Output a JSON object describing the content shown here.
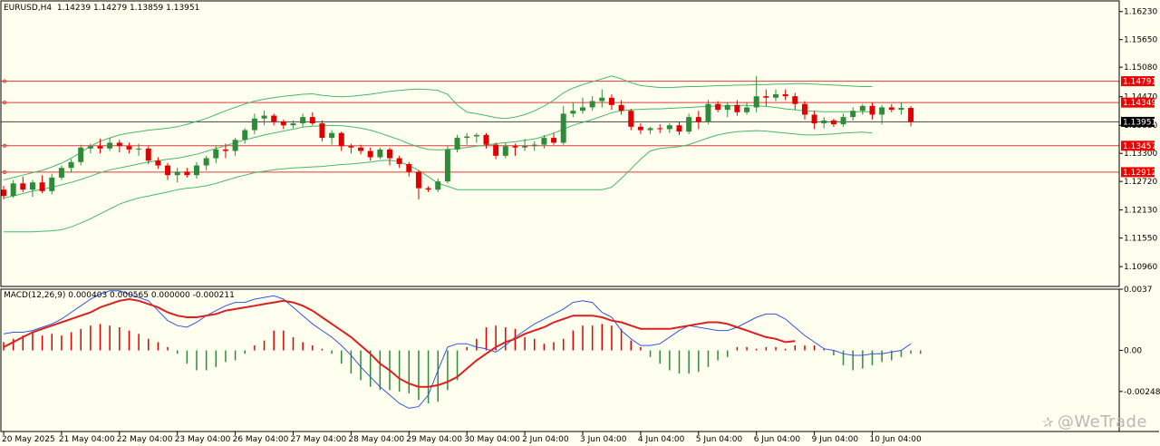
{
  "header": {
    "symbol": "EURUSD,H4",
    "open": "1.14239",
    "high": "1.14279",
    "low": "1.13859",
    "close": "1.13951"
  },
  "macd": {
    "label": "MACD(12,26,9)",
    "values": "0.000403 0.000565 0.000000 -0.000211"
  },
  "watermark": "@WeTrade",
  "colors": {
    "background": "#fffff0",
    "bull": "#2e8b3a",
    "bear": "#e00000",
    "bands": "#47b86a",
    "level_line": "#e53935",
    "level_box": "#f00000",
    "current_box": "#000000",
    "macd_line": "#3355dd",
    "signal_line": "#dd1f1f"
  },
  "price_axis": {
    "labels": [
      "1.16230",
      "1.15650",
      "1.15080",
      "1.14470",
      "1.13880",
      "1.13300",
      "1.12720",
      "1.12130",
      "1.11550",
      "1.10960"
    ],
    "range": [
      1.1055,
      1.1645
    ]
  },
  "levels": [
    {
      "label": "1.14791",
      "value": 1.14791
    },
    {
      "label": "1.14349",
      "value": 1.14349
    },
    {
      "label": "1.13457",
      "value": 1.13457
    },
    {
      "label": "1.12912",
      "value": 1.12912
    }
  ],
  "current": {
    "label": "1.13951",
    "value": 1.13951
  },
  "macd_axis": {
    "labels": [
      "0.0037",
      "0.00",
      "-0.002481"
    ],
    "range": [
      -0.0049,
      0.0037
    ]
  },
  "time_axis": {
    "labels": [
      "20 May 2025",
      "21 May 04:00",
      "22 May 04:00",
      "23 May 04:00",
      "26 May 04:00",
      "27 May 04:00",
      "28 May 04:00",
      "29 May 04:00",
      "30 May 04:00",
      "2 Jun 04:00",
      "3 Jun 04:00",
      "4 Jun 04:00",
      "5 Jun 04:00",
      "6 Jun 04:00",
      "9 Jun 04:00",
      "10 Jun 04:00"
    ],
    "label_candle_index": [
      0,
      6,
      12,
      18,
      24,
      30,
      36,
      42,
      48,
      54,
      60,
      66,
      72,
      78,
      84,
      90
    ]
  },
  "chart_data": {
    "type": "candlestick",
    "symbol": "EURUSD",
    "timeframe": "H4",
    "indicators": [
      "Bollinger Bands",
      "MACD(12,26,9)"
    ],
    "candles": [
      [
        1.1255,
        1.1263,
        1.1235,
        1.1242
      ],
      [
        1.1242,
        1.1275,
        1.1238,
        1.1268
      ],
      [
        1.1268,
        1.1282,
        1.125,
        1.1255
      ],
      [
        1.1255,
        1.1275,
        1.124,
        1.127
      ],
      [
        1.127,
        1.1285,
        1.1248,
        1.1252
      ],
      [
        1.1252,
        1.1288,
        1.1245,
        1.128
      ],
      [
        1.128,
        1.1305,
        1.1275,
        1.13
      ],
      [
        1.13,
        1.1318,
        1.129,
        1.1312
      ],
      [
        1.1312,
        1.1348,
        1.1305,
        1.1342
      ],
      [
        1.134,
        1.135,
        1.133,
        1.1345
      ],
      [
        1.1345,
        1.136,
        1.133,
        1.134
      ],
      [
        1.134,
        1.1362,
        1.1335,
        1.1352
      ],
      [
        1.1352,
        1.1358,
        1.1332,
        1.1345
      ],
      [
        1.1345,
        1.1352,
        1.133,
        1.1338
      ],
      [
        1.1338,
        1.135,
        1.1325,
        1.134
      ],
      [
        1.134,
        1.1345,
        1.1308,
        1.1315
      ],
      [
        1.1315,
        1.1322,
        1.1298,
        1.1305
      ],
      [
        1.1305,
        1.131,
        1.1275,
        1.1285
      ],
      [
        1.1285,
        1.13,
        1.127,
        1.1292
      ],
      [
        1.1292,
        1.13,
        1.128,
        1.1285
      ],
      [
        1.1285,
        1.1312,
        1.1278,
        1.1305
      ],
      [
        1.1305,
        1.1325,
        1.1295,
        1.132
      ],
      [
        1.132,
        1.1345,
        1.131,
        1.1338
      ],
      [
        1.1338,
        1.135,
        1.132,
        1.1335
      ],
      [
        1.1335,
        1.1362,
        1.1325,
        1.1358
      ],
      [
        1.1358,
        1.1382,
        1.135,
        1.1378
      ],
      [
        1.1378,
        1.1412,
        1.137,
        1.1402
      ],
      [
        1.1402,
        1.1418,
        1.1388,
        1.1408
      ],
      [
        1.1408,
        1.1412,
        1.1388,
        1.1395
      ],
      [
        1.1395,
        1.14,
        1.138,
        1.1388
      ],
      [
        1.1388,
        1.1398,
        1.1382,
        1.1392
      ],
      [
        1.1392,
        1.1412,
        1.1385,
        1.1405
      ],
      [
        1.1405,
        1.1415,
        1.1388,
        1.1392
      ],
      [
        1.1392,
        1.1398,
        1.1355,
        1.1362
      ],
      [
        1.1362,
        1.1378,
        1.1348,
        1.1372
      ],
      [
        1.1372,
        1.1375,
        1.1335,
        1.1345
      ],
      [
        1.1345,
        1.135,
        1.133,
        1.1342
      ],
      [
        1.1342,
        1.1348,
        1.1328,
        1.1335
      ],
      [
        1.1335,
        1.1342,
        1.1315,
        1.1322
      ],
      [
        1.1322,
        1.1342,
        1.1318,
        1.1338
      ],
      [
        1.1338,
        1.1342,
        1.1305,
        1.132
      ],
      [
        1.132,
        1.1325,
        1.13,
        1.1308
      ],
      [
        1.1308,
        1.1312,
        1.1282,
        1.1292
      ],
      [
        1.1292,
        1.1295,
        1.1235,
        1.1258
      ],
      [
        1.1258,
        1.1262,
        1.125,
        1.1255
      ],
      [
        1.1255,
        1.1278,
        1.125,
        1.1272
      ],
      [
        1.1272,
        1.1345,
        1.1268,
        1.1338
      ],
      [
        1.1338,
        1.1368,
        1.1332,
        1.1362
      ],
      [
        1.1362,
        1.1372,
        1.1348,
        1.1365
      ],
      [
        1.1365,
        1.1372,
        1.1352,
        1.1368
      ],
      [
        1.1368,
        1.1372,
        1.134,
        1.1348
      ],
      [
        1.1348,
        1.1352,
        1.1318,
        1.1325
      ],
      [
        1.1325,
        1.1352,
        1.132,
        1.1345
      ],
      [
        1.1345,
        1.135,
        1.1325,
        1.1342
      ],
      [
        1.1342,
        1.136,
        1.1335,
        1.1345
      ],
      [
        1.1345,
        1.1355,
        1.1335,
        1.1348
      ],
      [
        1.1348,
        1.1368,
        1.134,
        1.1362
      ],
      [
        1.1362,
        1.1372,
        1.1348,
        1.1352
      ],
      [
        1.1352,
        1.1428,
        1.1348,
        1.1412
      ],
      [
        1.1412,
        1.1435,
        1.1405,
        1.1418
      ],
      [
        1.1418,
        1.1445,
        1.1412,
        1.1425
      ],
      [
        1.1425,
        1.1448,
        1.1418,
        1.1438
      ],
      [
        1.1438,
        1.1462,
        1.1425,
        1.1445
      ],
      [
        1.1445,
        1.1452,
        1.142,
        1.143
      ],
      [
        1.143,
        1.144,
        1.141,
        1.1418
      ],
      [
        1.1418,
        1.1422,
        1.1378,
        1.1385
      ],
      [
        1.1385,
        1.1392,
        1.137,
        1.1378
      ],
      [
        1.1378,
        1.1385,
        1.137,
        1.1382
      ],
      [
        1.1382,
        1.139,
        1.1372,
        1.138
      ],
      [
        1.138,
        1.1392,
        1.1372,
        1.1388
      ],
      [
        1.1388,
        1.1395,
        1.1368,
        1.1375
      ],
      [
        1.1375,
        1.1412,
        1.137,
        1.1405
      ],
      [
        1.1405,
        1.1418,
        1.138,
        1.1395
      ],
      [
        1.1395,
        1.144,
        1.139,
        1.1432
      ],
      [
        1.1432,
        1.1438,
        1.1415,
        1.142
      ],
      [
        1.142,
        1.1435,
        1.1405,
        1.143
      ],
      [
        1.143,
        1.144,
        1.1408,
        1.1415
      ],
      [
        1.1415,
        1.1435,
        1.141,
        1.1425
      ],
      [
        1.1425,
        1.149,
        1.1415,
        1.1448
      ],
      [
        1.1448,
        1.1462,
        1.1428,
        1.1445
      ],
      [
        1.1445,
        1.1462,
        1.1438,
        1.1452
      ],
      [
        1.1452,
        1.1462,
        1.144,
        1.1448
      ],
      [
        1.1448,
        1.1455,
        1.142,
        1.1432
      ],
      [
        1.1432,
        1.1438,
        1.14,
        1.141
      ],
      [
        1.141,
        1.1418,
        1.138,
        1.1392
      ],
      [
        1.1392,
        1.1405,
        1.1382,
        1.1398
      ],
      [
        1.1398,
        1.1402,
        1.1385,
        1.139
      ],
      [
        1.139,
        1.1412,
        1.1385,
        1.1405
      ],
      [
        1.1405,
        1.1425,
        1.1398,
        1.1418
      ],
      [
        1.1418,
        1.1432,
        1.141,
        1.1428
      ],
      [
        1.1428,
        1.1435,
        1.14,
        1.141
      ],
      [
        1.141,
        1.143,
        1.139,
        1.1425
      ],
      [
        1.1425,
        1.1432,
        1.1415,
        1.142
      ],
      [
        1.142,
        1.1435,
        1.141,
        1.1424
      ],
      [
        1.14239,
        1.14279,
        1.13859,
        1.13951
      ]
    ],
    "bollinger": {
      "upper": [
        1.1275,
        1.128,
        1.1285,
        1.129,
        1.1295,
        1.1302,
        1.131,
        1.132,
        1.1332,
        1.1345,
        1.1355,
        1.1362,
        1.1368,
        1.1372,
        1.1375,
        1.1378,
        1.138,
        1.1382,
        1.1385,
        1.139,
        1.1396,
        1.1402,
        1.141,
        1.1418,
        1.1425,
        1.1432,
        1.1438,
        1.1442,
        1.1445,
        1.1448,
        1.145,
        1.1452,
        1.1453,
        1.145,
        1.1448,
        1.1447,
        1.1448,
        1.145,
        1.1452,
        1.1455,
        1.1458,
        1.146,
        1.1462,
        1.1463,
        1.1462,
        1.146,
        1.1452,
        1.143,
        1.1415,
        1.1412,
        1.1408,
        1.1404,
        1.1402,
        1.1405,
        1.141,
        1.1418,
        1.1428,
        1.144,
        1.1455,
        1.1465,
        1.1472,
        1.1478,
        1.1484,
        1.149,
        1.1484,
        1.1476,
        1.147,
        1.1468,
        1.1466,
        1.1466,
        1.1467,
        1.1468,
        1.1468,
        1.1469,
        1.147,
        1.147,
        1.1471,
        1.1471,
        1.1472,
        1.1472,
        1.1473,
        1.1473,
        1.1474,
        1.1474,
        1.1473,
        1.1472,
        1.1471,
        1.147,
        1.1469,
        1.1468,
        1.1468
      ],
      "middle": [
        1.1238,
        1.1242,
        1.1247,
        1.1252,
        1.1256,
        1.126,
        1.1265,
        1.127,
        1.1276,
        1.1283,
        1.129,
        1.1296,
        1.13,
        1.1304,
        1.1308,
        1.1312,
        1.1315,
        1.1318,
        1.132,
        1.1324,
        1.1328,
        1.1334,
        1.134,
        1.1346,
        1.1352,
        1.1358,
        1.1363,
        1.1368,
        1.1372,
        1.1376,
        1.138,
        1.1384,
        1.1386,
        1.1387,
        1.1388,
        1.1387,
        1.1385,
        1.1382,
        1.1378,
        1.1372,
        1.1365,
        1.1358,
        1.135,
        1.1343,
        1.1338,
        1.1337,
        1.1338,
        1.134,
        1.1342,
        1.1345,
        1.1347,
        1.135,
        1.1352,
        1.1354,
        1.1357,
        1.136,
        1.1365,
        1.1372,
        1.138,
        1.1388,
        1.1394,
        1.14,
        1.1407,
        1.1414,
        1.1418,
        1.142,
        1.1421,
        1.1422,
        1.1422,
        1.1423,
        1.1424,
        1.1425,
        1.1426,
        1.1427,
        1.1428,
        1.1428,
        1.1429,
        1.1429,
        1.1428,
        1.1427,
        1.1425,
        1.1422,
        1.142,
        1.1418,
        1.1417,
        1.1416,
        1.1416,
        1.1416,
        1.1416,
        1.1416,
        1.1416
      ],
      "lower": [
        1.1168,
        1.1168,
        1.1168,
        1.1168,
        1.1169,
        1.117,
        1.1172,
        1.1178,
        1.1186,
        1.1195,
        1.1205,
        1.1215,
        1.1225,
        1.1232,
        1.1238,
        1.1242,
        1.1246,
        1.125,
        1.1255,
        1.1258,
        1.126,
        1.1263,
        1.1268,
        1.1274,
        1.128,
        1.1285,
        1.129,
        1.1293,
        1.1296,
        1.1298,
        1.13,
        1.1301,
        1.1302,
        1.1303,
        1.1305,
        1.1307,
        1.1308,
        1.131,
        1.1312,
        1.1315,
        1.1316,
        1.1313,
        1.1305,
        1.1295,
        1.1282,
        1.1268,
        1.1262,
        1.1255,
        1.1255,
        1.1255,
        1.1255,
        1.1255,
        1.1255,
        1.1255,
        1.1255,
        1.1255,
        1.1255,
        1.1255,
        1.1255,
        1.1255,
        1.1255,
        1.1255,
        1.1255,
        1.126,
        1.1278,
        1.1298,
        1.1318,
        1.1335,
        1.134,
        1.1342,
        1.1344,
        1.1348,
        1.1355,
        1.1362,
        1.1368,
        1.1372,
        1.1375,
        1.1376,
        1.1377,
        1.1376,
        1.1374,
        1.1372,
        1.137,
        1.1368,
        1.1368,
        1.1369,
        1.137,
        1.1372,
        1.1373,
        1.1374,
        1.1372
      ]
    },
    "macd": {
      "histogram": [
        0.0005,
        0.0007,
        0.0009,
        0.0011,
        0.0009,
        0.001,
        0.0009,
        0.0011,
        0.0013,
        0.0015,
        0.0016,
        0.0015,
        0.0014,
        0.0012,
        0.001,
        0.0007,
        0.0005,
        0.0002,
        -0.0002,
        -0.0008,
        -0.0012,
        -0.0012,
        -0.001,
        -0.0007,
        -0.0006,
        -0.0002,
        0.0003,
        0.0006,
        0.0012,
        0.0012,
        0.0008,
        0.0005,
        0.0003,
        0.0001,
        -0.0002,
        -0.0008,
        -0.0014,
        -0.0018,
        -0.0022,
        -0.0024,
        -0.0024,
        -0.0025,
        -0.0026,
        -0.003,
        -0.0032,
        -0.0031,
        -0.0024,
        -0.0018,
        0.0002,
        0.0007,
        0.0014,
        0.0015,
        0.0014,
        0.0013,
        0.0008,
        0.0007,
        0.0004,
        0.0005,
        0.0007,
        0.0012,
        0.0015,
        0.0015,
        0.0016,
        0.0015,
        0.0013,
        0.0006,
        0.0002,
        -0.0004,
        -0.0008,
        -0.0012,
        -0.0014,
        -0.0014,
        -0.0013,
        -0.001,
        -0.0006,
        -0.0004,
        0.0002,
        0.0002,
        0.0001,
        0.0002,
        0.0002,
        0.0001,
        0.0003,
        0.0003,
        0.0003,
        0.0001,
        -0.0003,
        -0.0009,
        -0.0012,
        -0.0011,
        -0.0009,
        -0.0007,
        -0.0006,
        -0.0004,
        -0.0002,
        -0.000211
      ],
      "macd_line": [
        0.001,
        0.0011,
        0.0011,
        0.0012,
        0.0014,
        0.0016,
        0.0019,
        0.0023,
        0.0027,
        0.0031,
        0.0034,
        0.0036,
        0.0036,
        0.0034,
        0.0032,
        0.003,
        0.0024,
        0.0018,
        0.0015,
        0.0014,
        0.0017,
        0.0021,
        0.0024,
        0.0027,
        0.0029,
        0.0029,
        0.0031,
        0.0032,
        0.0033,
        0.0031,
        0.0026,
        0.0021,
        0.0016,
        0.0012,
        0.0008,
        0.0003,
        -0.0003,
        -0.001,
        -0.0016,
        -0.0022,
        -0.0027,
        -0.0032,
        -0.0035,
        -0.0034,
        -0.0027,
        -0.0012,
        0.0002,
        0.0004,
        0.0004,
        0.0002,
        0.0001,
        -0.0001,
        0.0003,
        0.0008,
        0.0012,
        0.0016,
        0.0019,
        0.0022,
        0.0025,
        0.0029,
        0.003,
        0.0029,
        0.0023,
        0.002,
        0.0012,
        0.0007,
        0.0003,
        0.0003,
        0.0004,
        0.0008,
        0.0012,
        0.0015,
        0.0014,
        0.0013,
        0.0012,
        0.0012,
        0.0014,
        0.0017,
        0.002,
        0.0022,
        0.0022,
        0.0019,
        0.0014,
        0.0009,
        0.0005,
        0.0001,
        -0.0,
        -0.0002,
        -0.0003,
        -0.0003,
        -0.0002,
        -0.0002,
        -0.0001,
        0.0,
        0.000403
      ],
      "signal_line": [
        0.0002,
        0.0005,
        0.0008,
        0.0011,
        0.0013,
        0.0015,
        0.0017,
        0.0019,
        0.0021,
        0.0023,
        0.0026,
        0.0028,
        0.003,
        0.0031,
        0.003,
        0.0028,
        0.0026,
        0.0023,
        0.0021,
        0.002,
        0.002,
        0.0021,
        0.0022,
        0.0024,
        0.0025,
        0.0026,
        0.0027,
        0.0028,
        0.0029,
        0.003,
        0.0029,
        0.0027,
        0.0024,
        0.002,
        0.0016,
        0.0012,
        0.0008,
        0.0003,
        -0.0002,
        -0.0008,
        -0.0012,
        -0.0017,
        -0.002,
        -0.0022,
        -0.0022,
        -0.0021,
        -0.0019,
        -0.0016,
        -0.0011,
        -0.0006,
        -0.0002,
        0.0002,
        0.0005,
        0.0007,
        0.001,
        0.0012,
        0.0014,
        0.0017,
        0.0019,
        0.0021,
        0.0021,
        0.0021,
        0.002,
        0.0018,
        0.0017,
        0.0015,
        0.0013,
        0.0013,
        0.0013,
        0.0013,
        0.0014,
        0.0015,
        0.0016,
        0.0017,
        0.0017,
        0.0016,
        0.0014,
        0.0012,
        0.001,
        0.0008,
        0.0007,
        0.0005,
        0.000565
      ]
    }
  }
}
